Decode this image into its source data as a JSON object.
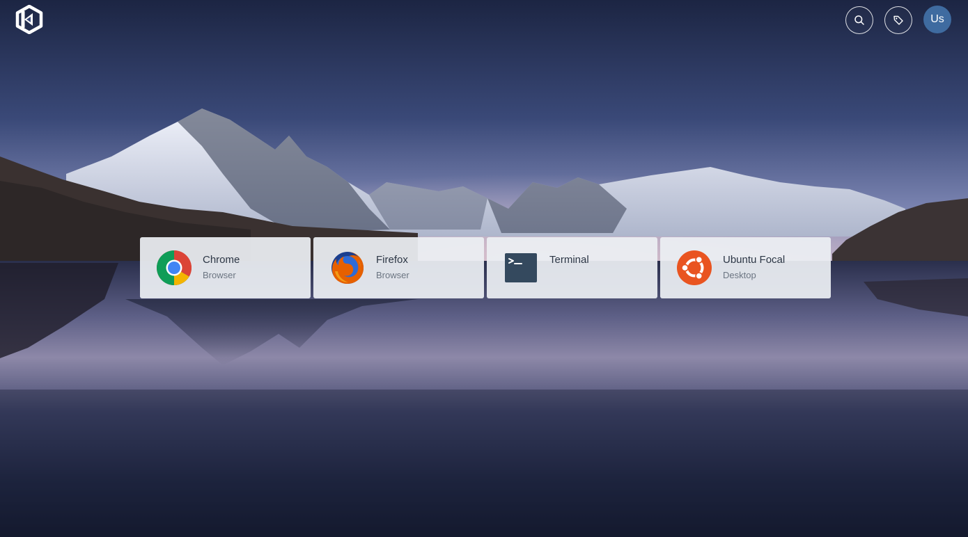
{
  "header": {
    "logo_icon": "kasm-logo-icon",
    "search_icon": "search-icon",
    "tags_icon": "tag-icon",
    "avatar_initials": "Us",
    "avatar_color": "#3f6ba0"
  },
  "apps": [
    {
      "title": "Chrome",
      "subtitle": "Browser",
      "icon": "chrome-icon"
    },
    {
      "title": "Firefox",
      "subtitle": "Browser",
      "icon": "firefox-icon"
    },
    {
      "title": "Terminal",
      "subtitle": "",
      "icon": "terminal-icon"
    },
    {
      "title": "Ubuntu Focal",
      "subtitle": "Desktop",
      "icon": "ubuntu-icon"
    }
  ],
  "colors": {
    "card_background": "#eceff3",
    "card_title": "#2c3645",
    "card_subtitle": "#6b7582",
    "ubuntu_orange": "#e95420",
    "terminal_background": "#34495e"
  }
}
